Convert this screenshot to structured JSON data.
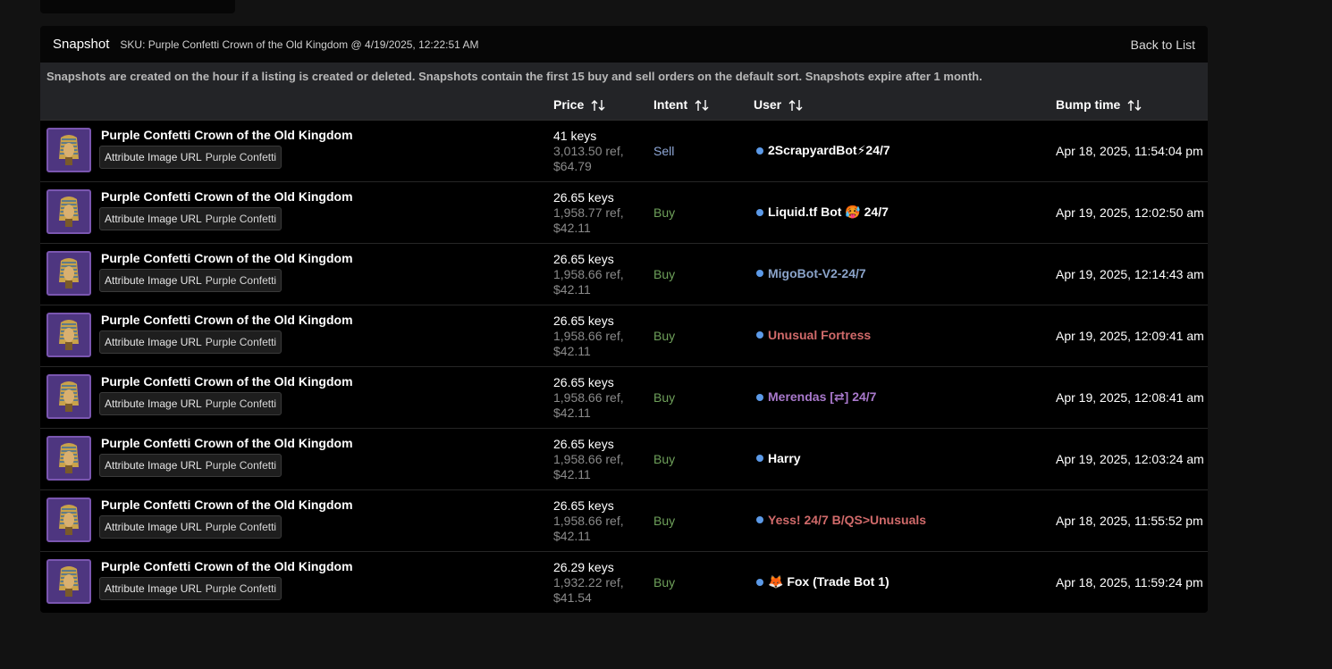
{
  "header": {
    "title": "Snapshot",
    "sku": "SKU: Purple Confetti Crown of the Old Kingdom @ 4/19/2025, 12:22:51 AM",
    "back": "Back to List"
  },
  "notice": "Snapshots are created on the hour if a listing is created or deleted. Snapshots contain the first 15 buy and sell orders on the default sort. Snapshots expire after 1 month.",
  "columns": {
    "price": "Price",
    "intent": "Intent",
    "user": "User",
    "bump": "Bump time"
  },
  "colors": {
    "sell": "#8fa8d8",
    "buy": "#6ea05a",
    "online_dot": "#5c9ae8",
    "thumb_bg": "#4e3680"
  },
  "rows": [
    {
      "item": "Purple Confetti Crown of the Old Kingdom",
      "attr_label": "Attribute Image URL",
      "attr_value": "Purple Confetti",
      "keys": "41 keys",
      "ref": "3,013.50 ref,",
      "usd": "$64.79",
      "intent": "Sell",
      "user": "2ScrapyardBot⚡24/7",
      "user_color": "#ffffff",
      "bump": "Apr 18, 2025, 11:54:04 pm"
    },
    {
      "item": "Purple Confetti Crown of the Old Kingdom",
      "attr_label": "Attribute Image URL",
      "attr_value": "Purple Confetti",
      "keys": "26.65 keys",
      "ref": "1,958.77 ref,",
      "usd": "$42.11",
      "intent": "Buy",
      "user": "Liquid.tf Bot 🥵 24/7",
      "user_color": "#ffffff",
      "bump": "Apr 19, 2025, 12:02:50 am"
    },
    {
      "item": "Purple Confetti Crown of the Old Kingdom",
      "attr_label": "Attribute Image URL",
      "attr_value": "Purple Confetti",
      "keys": "26.65 keys",
      "ref": "1,958.66 ref,",
      "usd": "$42.11",
      "intent": "Buy",
      "user": "MigoBot-V2-24/7",
      "user_color": "#8aa3c9",
      "bump": "Apr 19, 2025, 12:14:43 am"
    },
    {
      "item": "Purple Confetti Crown of the Old Kingdom",
      "attr_label": "Attribute Image URL",
      "attr_value": "Purple Confetti",
      "keys": "26.65 keys",
      "ref": "1,958.66 ref,",
      "usd": "$42.11",
      "intent": "Buy",
      "user": "Unusual Fortress",
      "user_color": "#d06a6a",
      "bump": "Apr 19, 2025, 12:09:41 am"
    },
    {
      "item": "Purple Confetti Crown of the Old Kingdom",
      "attr_label": "Attribute Image URL",
      "attr_value": "Purple Confetti",
      "keys": "26.65 keys",
      "ref": "1,958.66 ref,",
      "usd": "$42.11",
      "intent": "Buy",
      "user": "Merendas [⇄] 24/7",
      "user_color": "#a979cc",
      "bump": "Apr 19, 2025, 12:08:41 am"
    },
    {
      "item": "Purple Confetti Crown of the Old Kingdom",
      "attr_label": "Attribute Image URL",
      "attr_value": "Purple Confetti",
      "keys": "26.65 keys",
      "ref": "1,958.66 ref,",
      "usd": "$42.11",
      "intent": "Buy",
      "user": "Harry",
      "user_color": "#ffffff",
      "bump": "Apr 19, 2025, 12:03:24 am"
    },
    {
      "item": "Purple Confetti Crown of the Old Kingdom",
      "attr_label": "Attribute Image URL",
      "attr_value": "Purple Confetti",
      "keys": "26.65 keys",
      "ref": "1,958.66 ref,",
      "usd": "$42.11",
      "intent": "Buy",
      "user": "Yess! 24/7 B/QS>Unusuals",
      "user_color": "#d06a6a",
      "bump": "Apr 18, 2025, 11:55:52 pm"
    },
    {
      "item": "Purple Confetti Crown of the Old Kingdom",
      "attr_label": "Attribute Image URL",
      "attr_value": "Purple Confetti",
      "keys": "26.29 keys",
      "ref": "1,932.22 ref,",
      "usd": "$41.54",
      "intent": "Buy",
      "user": "🦊 Fox (Trade Bot 1)",
      "user_color": "#ffffff",
      "bump": "Apr 18, 2025, 11:59:24 pm"
    }
  ]
}
